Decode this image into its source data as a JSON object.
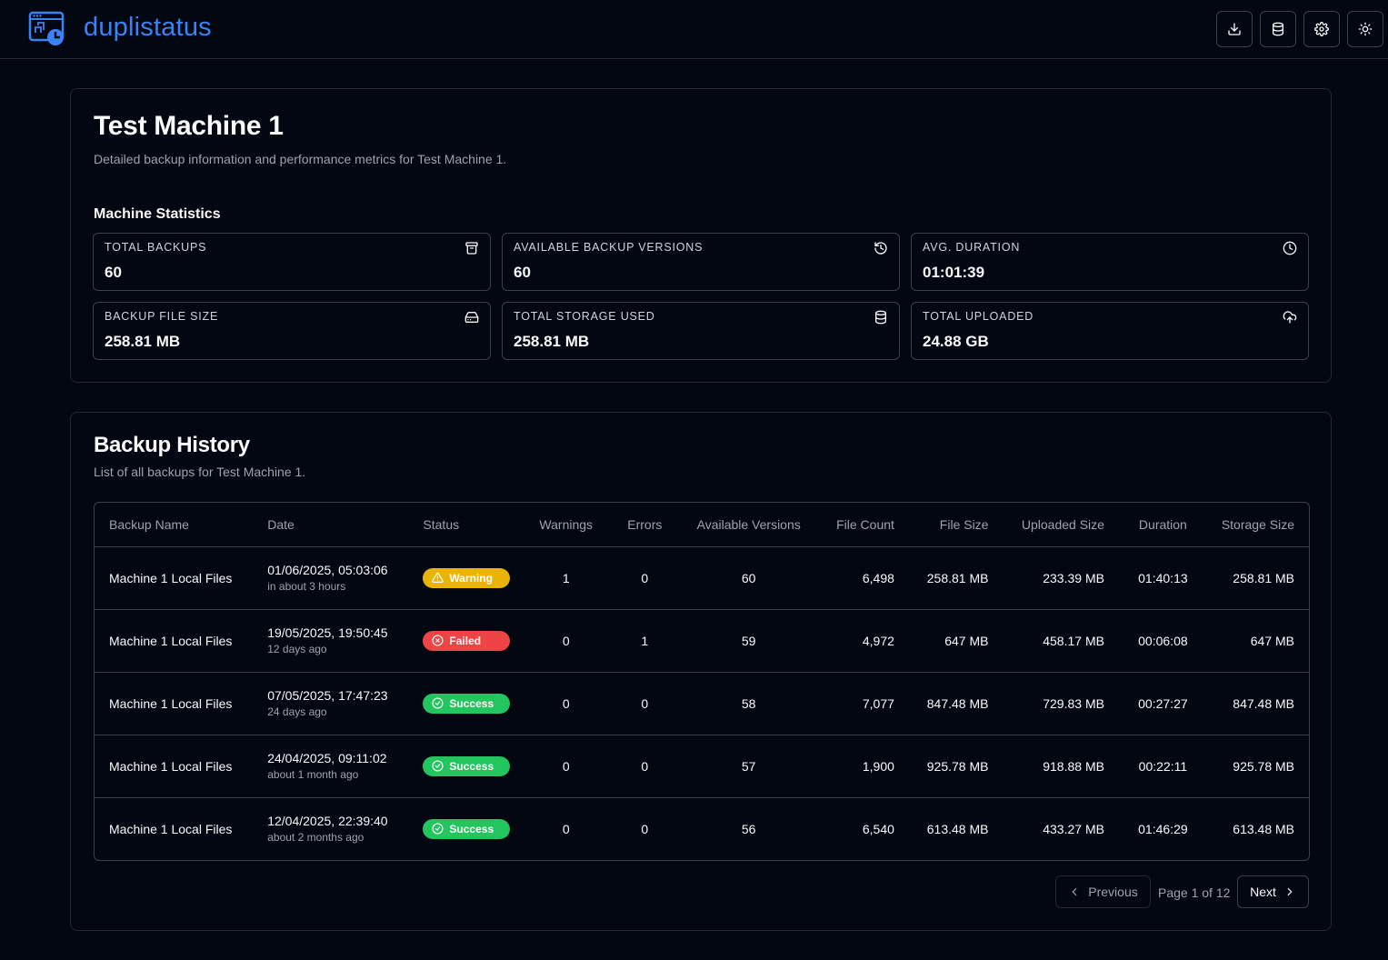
{
  "app": {
    "title": "duplistatus"
  },
  "header": {
    "icons": [
      "download-icon",
      "database-icon",
      "gear-icon",
      "sun-icon"
    ]
  },
  "machine": {
    "title": "Test Machine 1",
    "subtitle": "Detailed backup information and performance metrics for Test Machine 1.",
    "stats_title": "Machine Statistics",
    "stats": [
      {
        "label": "TOTAL BACKUPS",
        "value": "60",
        "icon": "archive-icon"
      },
      {
        "label": "AVAILABLE BACKUP VERSIONS",
        "value": "60",
        "icon": "history-icon"
      },
      {
        "label": "AVG. DURATION",
        "value": "01:01:39",
        "icon": "clock-icon"
      },
      {
        "label": "BACKUP FILE SIZE",
        "value": "258.81 MB",
        "icon": "hard-drive-icon"
      },
      {
        "label": "TOTAL STORAGE USED",
        "value": "258.81 MB",
        "icon": "database-icon"
      },
      {
        "label": "TOTAL UPLOADED",
        "value": "24.88 GB",
        "icon": "cloud-upload-icon"
      }
    ]
  },
  "history": {
    "title": "Backup History",
    "subtitle": "List of all backups for Test Machine 1.",
    "columns": [
      "Backup Name",
      "Date",
      "Status",
      "Warnings",
      "Errors",
      "Available Versions",
      "File Count",
      "File Size",
      "Uploaded Size",
      "Duration",
      "Storage Size"
    ],
    "rows": [
      {
        "name": "Machine 1 Local Files",
        "date": "01/06/2025, 05:03:06",
        "relative": "in about 3 hours",
        "status": "Warning",
        "warnings": "1",
        "errors": "0",
        "versions": "60",
        "file_count": "6,498",
        "file_size": "258.81 MB",
        "uploaded": "233.39 MB",
        "duration": "01:40:13",
        "storage": "258.81 MB"
      },
      {
        "name": "Machine 1 Local Files",
        "date": "19/05/2025, 19:50:45",
        "relative": "12 days ago",
        "status": "Failed",
        "warnings": "0",
        "errors": "1",
        "versions": "59",
        "file_count": "4,972",
        "file_size": "647 MB",
        "uploaded": "458.17 MB",
        "duration": "00:06:08",
        "storage": "647 MB"
      },
      {
        "name": "Machine 1 Local Files",
        "date": "07/05/2025, 17:47:23",
        "relative": "24 days ago",
        "status": "Success",
        "warnings": "0",
        "errors": "0",
        "versions": "58",
        "file_count": "7,077",
        "file_size": "847.48 MB",
        "uploaded": "729.83 MB",
        "duration": "00:27:27",
        "storage": "847.48 MB"
      },
      {
        "name": "Machine 1 Local Files",
        "date": "24/04/2025, 09:11:02",
        "relative": "about 1 month ago",
        "status": "Success",
        "warnings": "0",
        "errors": "0",
        "versions": "57",
        "file_count": "1,900",
        "file_size": "925.78 MB",
        "uploaded": "918.88 MB",
        "duration": "00:22:11",
        "storage": "925.78 MB"
      },
      {
        "name": "Machine 1 Local Files",
        "date": "12/04/2025, 22:39:40",
        "relative": "about 2 months ago",
        "status": "Success",
        "warnings": "0",
        "errors": "0",
        "versions": "56",
        "file_count": "6,540",
        "file_size": "613.48 MB",
        "uploaded": "433.27 MB",
        "duration": "01:46:29",
        "storage": "613.48 MB"
      }
    ],
    "status_colors": {
      "Warning": "#eab308",
      "Failed": "#ef4444",
      "Success": "#22c55e"
    },
    "pagination": {
      "previous": "Previous",
      "page_text": "Page 1 of 12",
      "next": "Next"
    }
  },
  "colors": {
    "accent": "#3b82f6",
    "background": "#030712",
    "border": "#374151"
  }
}
